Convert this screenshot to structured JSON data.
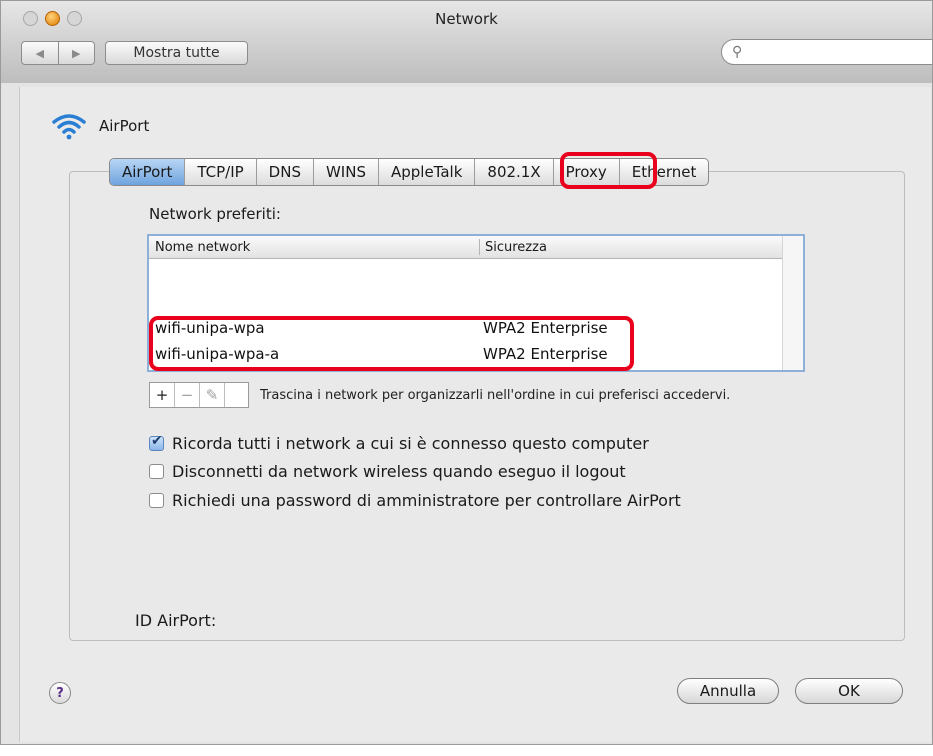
{
  "window": {
    "title": "Network"
  },
  "toolbar": {
    "show_all_label": "Mostra tutte",
    "back_glyph": "◀",
    "forward_glyph": "▶",
    "search_glyph": "⚲",
    "search_placeholder": ""
  },
  "header": {
    "service_name": "AirPort",
    "icon": "wifi-icon"
  },
  "tabs": [
    "AirPort",
    "TCP/IP",
    "DNS",
    "WINS",
    "AppleTalk",
    "802.1X",
    "Proxy",
    "Ethernet"
  ],
  "active_tab": "AirPort",
  "preferred": {
    "label": "Network preferiti:",
    "columns": [
      "Nome network",
      "Sicurezza"
    ],
    "rows": [
      {
        "name": "wifi-unipa-wpa",
        "security": "WPA2 Enterprise"
      },
      {
        "name": "wifi-unipa-wpa-a",
        "security": "WPA2 Enterprise"
      }
    ],
    "buttons": {
      "add": "+",
      "remove": "−",
      "edit": "✎"
    },
    "drag_hint": "Trascina i network per organizzarli nell'ordine in cui preferisci accedervi."
  },
  "options": [
    {
      "label": "Ricorda tutti i network a cui si è connesso questo computer",
      "checked": true
    },
    {
      "label": "Disconnetti da network wireless quando eseguo il logout",
      "checked": false
    },
    {
      "label": "Richiedi una password di amministratore per controllare AirPort",
      "checked": false
    }
  ],
  "airport_id_label": "ID AirPort:",
  "footer": {
    "help_label": "?",
    "cancel_label": "Annulla",
    "ok_label": "OK"
  },
  "colors": {
    "highlight": "#e8001c",
    "active_tab": "#6fa3de"
  }
}
